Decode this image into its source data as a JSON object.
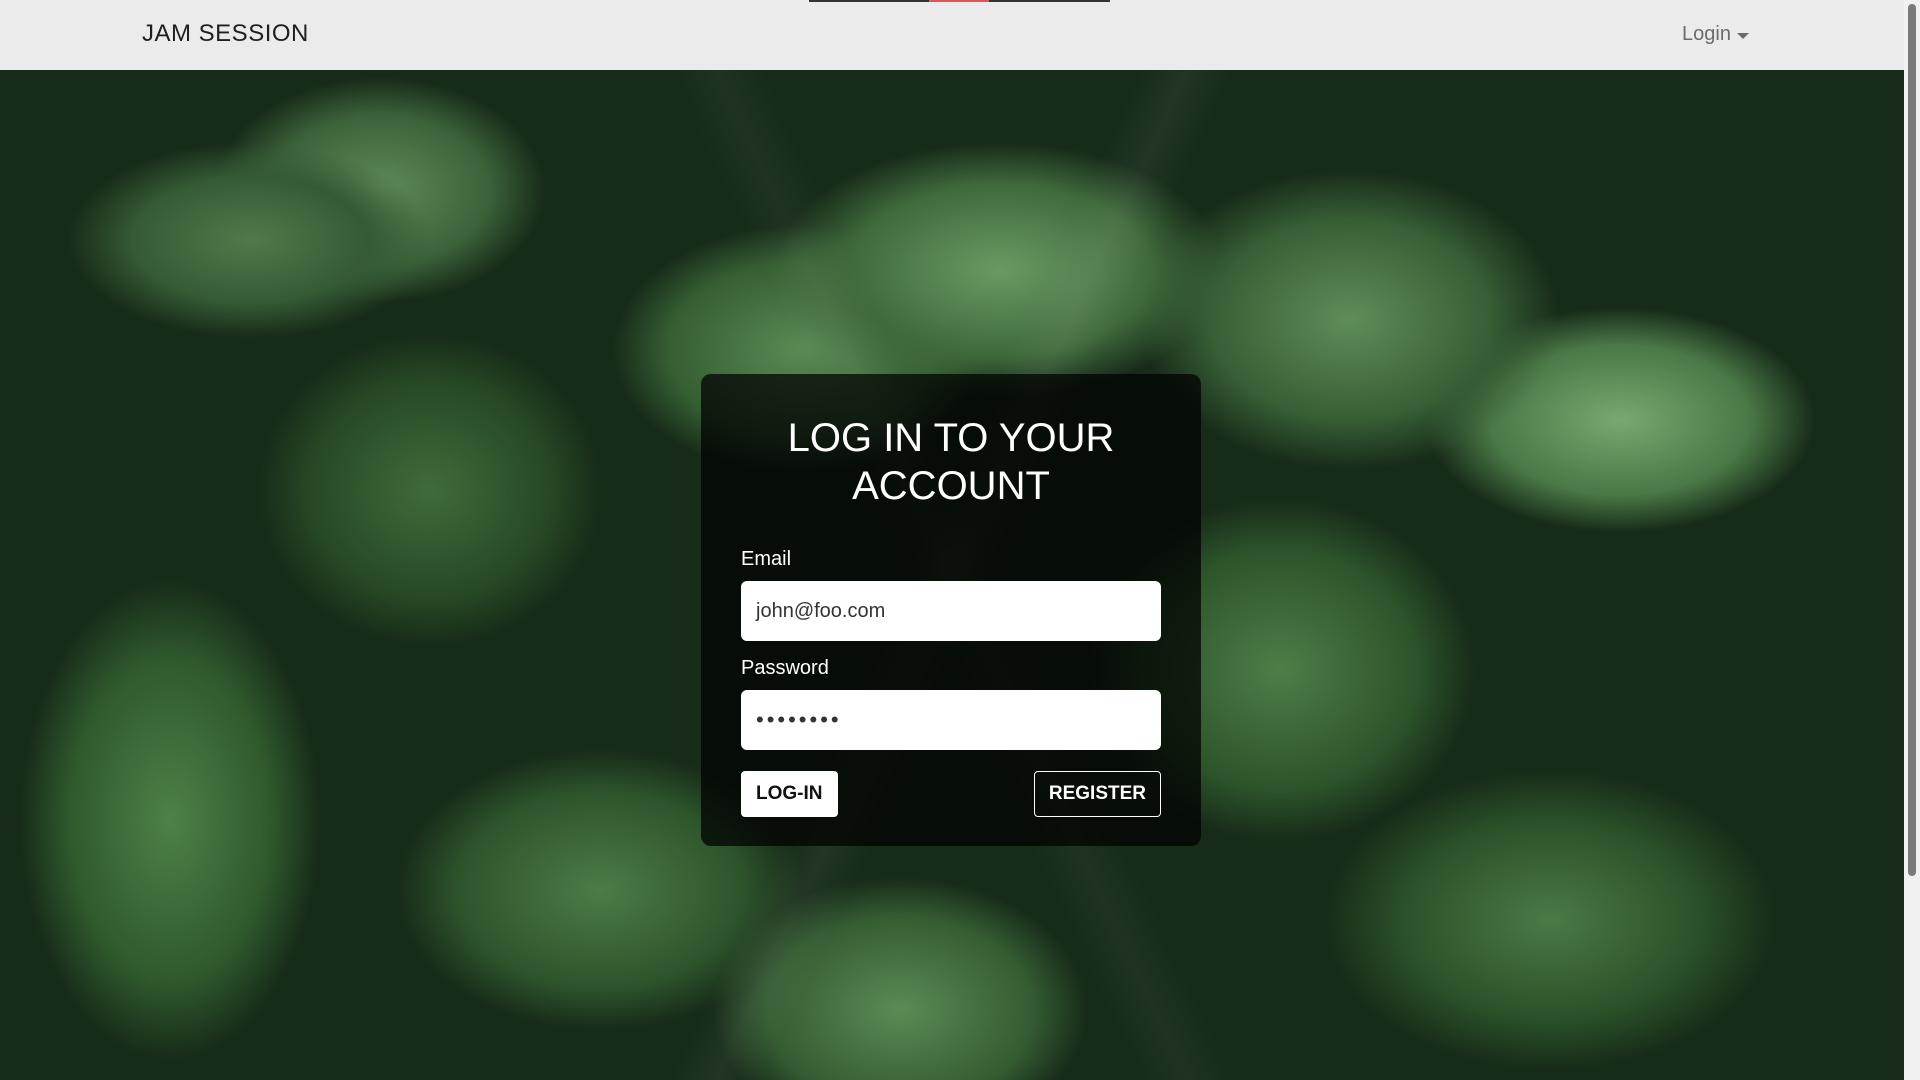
{
  "navbar": {
    "brand": "JAM SESSION",
    "login_menu": "Login"
  },
  "login_card": {
    "title": "LOG IN TO YOUR ACCOUNT",
    "email_label": "Email",
    "email_value": "john@foo.com",
    "password_label": "Password",
    "password_value": "••••••••",
    "login_button": "LOG-IN",
    "register_button": "REGISTER"
  },
  "colors": {
    "navbar_bg": "#ebebeb",
    "card_bg": "rgba(0,0,0,0.72)",
    "accent_text": "#ffffff"
  },
  "icons": {
    "login_caret": "chevron-down-icon"
  }
}
